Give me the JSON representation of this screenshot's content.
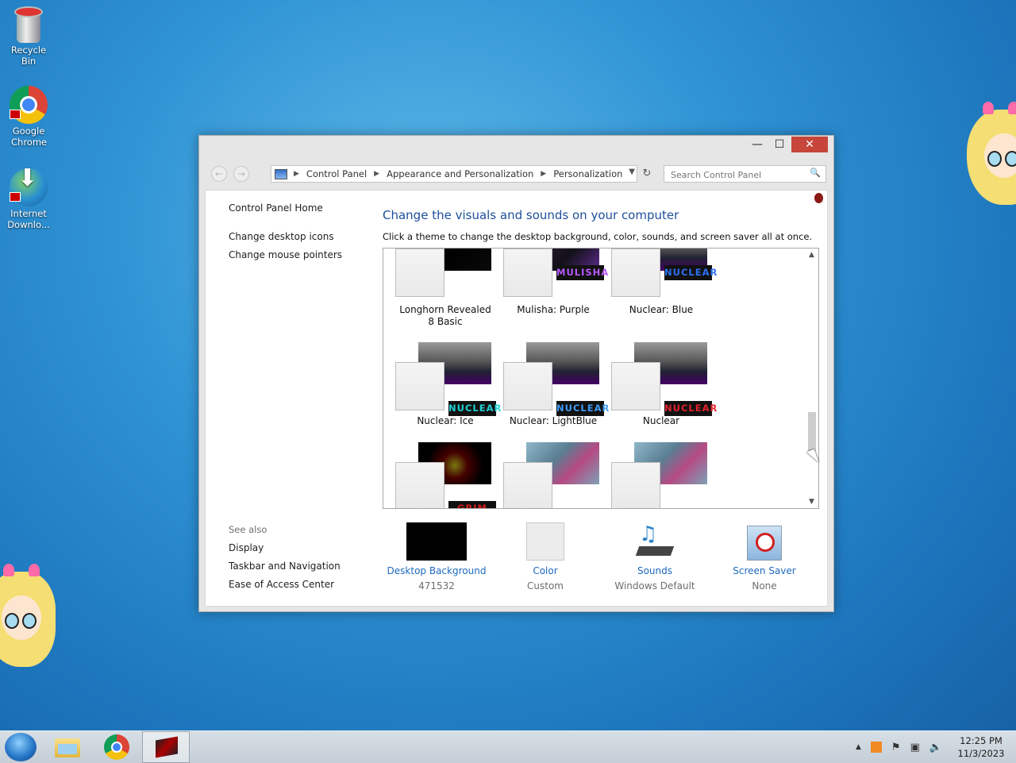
{
  "desktop": {
    "icons": [
      {
        "label": "Recycle Bin"
      },
      {
        "label": "Google Chrome"
      },
      {
        "label": "Internet Downlo..."
      }
    ]
  },
  "window": {
    "controls": {
      "minimize": "—",
      "maximize": "☐",
      "close": "✕"
    },
    "address": {
      "breadcrumbs": [
        "Control Panel",
        "Appearance and Personalization",
        "Personalization"
      ]
    },
    "search": {
      "placeholder": "Search Control Panel"
    },
    "sidebar": {
      "home": "Control Panel Home",
      "links": [
        "Change desktop icons",
        "Change mouse pointers"
      ],
      "see_also_title": "See also",
      "see_also": [
        "Display",
        "Taskbar and Navigation",
        "Ease of Access Center"
      ]
    },
    "main": {
      "heading": "Change the visuals and sounds on your computer",
      "subtext": "Click a theme to change the desktop background, color, sounds, and screen saver all at once.",
      "themes": [
        {
          "name": "Longhorn Revealed 8 Basic",
          "logo": "",
          "logo_color": "#ffffff"
        },
        {
          "name": "Mulisha: Purple",
          "logo": "MULISHA",
          "logo_color": "#b659ff"
        },
        {
          "name": "Nuclear: Blue",
          "logo": "NUCLEAR",
          "logo_color": "#2f6ff2"
        },
        {
          "name": "Nuclear: Ice",
          "logo": "NUCLEAR",
          "logo_color": "#1fd1d6"
        },
        {
          "name": "Nuclear: LightBlue",
          "logo": "NUCLEAR",
          "logo_color": "#3d9bf5"
        },
        {
          "name": "Nuclear",
          "logo": "NUCLEAR",
          "logo_color": "#e4222b"
        },
        {
          "name": "",
          "logo": "GRIM",
          "logo_color": "#d81b1b"
        },
        {
          "name": "",
          "logo": "",
          "logo_color": "#ffffff"
        },
        {
          "name": "",
          "logo": "",
          "logo_color": "#ffffff"
        }
      ],
      "bottom": [
        {
          "title": "Desktop Background",
          "value": "471532"
        },
        {
          "title": "Color",
          "value": "Custom"
        },
        {
          "title": "Sounds",
          "value": "Windows Default"
        },
        {
          "title": "Screen Saver",
          "value": "None"
        }
      ]
    }
  },
  "taskbar": {
    "clock": {
      "time": "12:25 PM",
      "date": "11/3/2023"
    }
  }
}
